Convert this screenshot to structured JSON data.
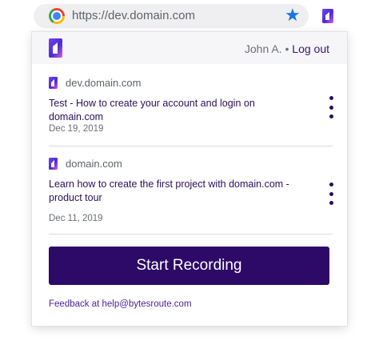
{
  "browser": {
    "url": "https://dev.domain.com",
    "browser_icon": "chrome-icon",
    "bookmark_icon": "star-icon",
    "extension_icon": "app-logo-icon"
  },
  "header": {
    "user_name": "John A.",
    "separator": "•",
    "logout_label": "Log out"
  },
  "recordings": [
    {
      "domain": "dev.domain.com",
      "title": "Test - How to create your account and login on domain.com",
      "date": "Dec 19, 2019"
    },
    {
      "domain": "domain.com",
      "title": "Learn how to create the first project with domain.com - product tour",
      "date": "Dec 11, 2019"
    }
  ],
  "start_button_label": "Start Recording",
  "feedback_text": "Feedback at help@bytesroute.com",
  "colors": {
    "brand": "#2d0a68",
    "link": "#3a1477",
    "bookmark_star": "#1a73e8"
  }
}
